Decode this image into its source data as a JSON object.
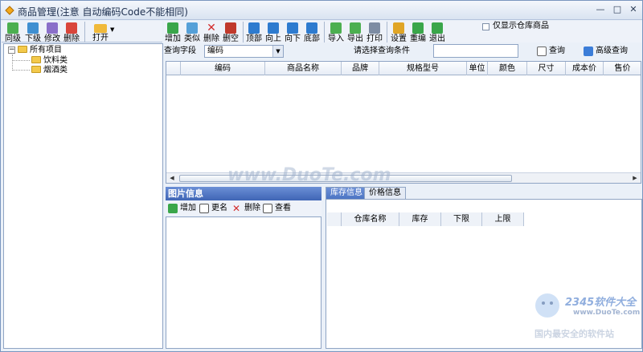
{
  "window": {
    "title": "商品管理(注意 自动编码Code不能相同)",
    "controls": [
      "—",
      "□",
      "✕"
    ]
  },
  "left_toolbar": [
    {
      "label": "同级",
      "icon": "add-sibling-icon",
      "color": "#4caf50"
    },
    {
      "label": "下级",
      "icon": "add-child-icon",
      "color": "#3f8fd1"
    },
    {
      "label": "修改",
      "icon": "edit-icon",
      "color": "#8a6fc9"
    },
    {
      "label": "删除",
      "icon": "delete-icon",
      "color": "#d9453a"
    },
    {
      "label": "打开",
      "icon": "open-folder-icon",
      "color": "#f0b93a"
    }
  ],
  "tree": {
    "root": "所有项目",
    "children": [
      "饮料类",
      "烟酒类"
    ]
  },
  "main_toolbar": [
    {
      "label": "增加",
      "icon": "add-icon",
      "color": "#3aa64a"
    },
    {
      "label": "类似",
      "icon": "copy-similar-icon",
      "color": "#55a0d8"
    },
    {
      "label": "删除",
      "icon": "delete-icon",
      "color": "#d22c2c"
    },
    {
      "label": "删空",
      "icon": "clear-all-icon",
      "color": "#c0392b"
    },
    {
      "label": "顶部",
      "icon": "move-top-icon",
      "color": "#2e7bcf"
    },
    {
      "label": "向上",
      "icon": "move-up-icon",
      "color": "#2e7bcf"
    },
    {
      "label": "向下",
      "icon": "move-down-icon",
      "color": "#2e7bcf"
    },
    {
      "label": "底部",
      "icon": "move-bottom-icon",
      "color": "#2e7bcf"
    },
    {
      "label": "导入",
      "icon": "import-icon",
      "color": "#4caf50"
    },
    {
      "label": "导出",
      "icon": "export-icon",
      "color": "#4caf50"
    },
    {
      "label": "打印",
      "icon": "print-icon",
      "color": "#7d8ca3"
    },
    {
      "label": "设置",
      "icon": "settings-icon",
      "color": "#e0a526"
    },
    {
      "label": "重编",
      "icon": "renumber-icon",
      "color": "#3aa64a"
    },
    {
      "label": "退出",
      "icon": "exit-icon",
      "color": "#3aa64a"
    }
  ],
  "warehouse_only_label": "仅显示仓库商品",
  "query": {
    "field_label": "查询字段",
    "field_value": "编码",
    "condition_label": "请选择查询条件",
    "condition_value": "",
    "search_label": "查询",
    "advanced_label": "高级查询"
  },
  "product_grid": {
    "columns": [
      "编码",
      "商品名称",
      "品牌",
      "规格型号",
      "单位",
      "颜色",
      "尺寸",
      "成本价",
      "售价"
    ]
  },
  "image_panel": {
    "title": "图片信息",
    "actions": [
      {
        "label": "增加",
        "icon": "add-icon",
        "color": "#3aa64a"
      },
      {
        "label": "更名",
        "icon": "rename-icon",
        "color": "#555555"
      },
      {
        "label": "删除",
        "icon": "delete-icon",
        "color": "#d22c2c"
      },
      {
        "label": "查看",
        "icon": "view-icon",
        "color": "#555555"
      }
    ]
  },
  "tabs": [
    "库存信息",
    "价格信息"
  ],
  "stock_grid": {
    "columns": [
      "仓库名称",
      "库存",
      "下限",
      "上限"
    ]
  },
  "watermarks": {
    "center": "www.DuoTe.com",
    "brand": "2345软件大全",
    "brand_url": "www.DuoTe.com",
    "brand_sub": "国内最安全的软件站"
  }
}
